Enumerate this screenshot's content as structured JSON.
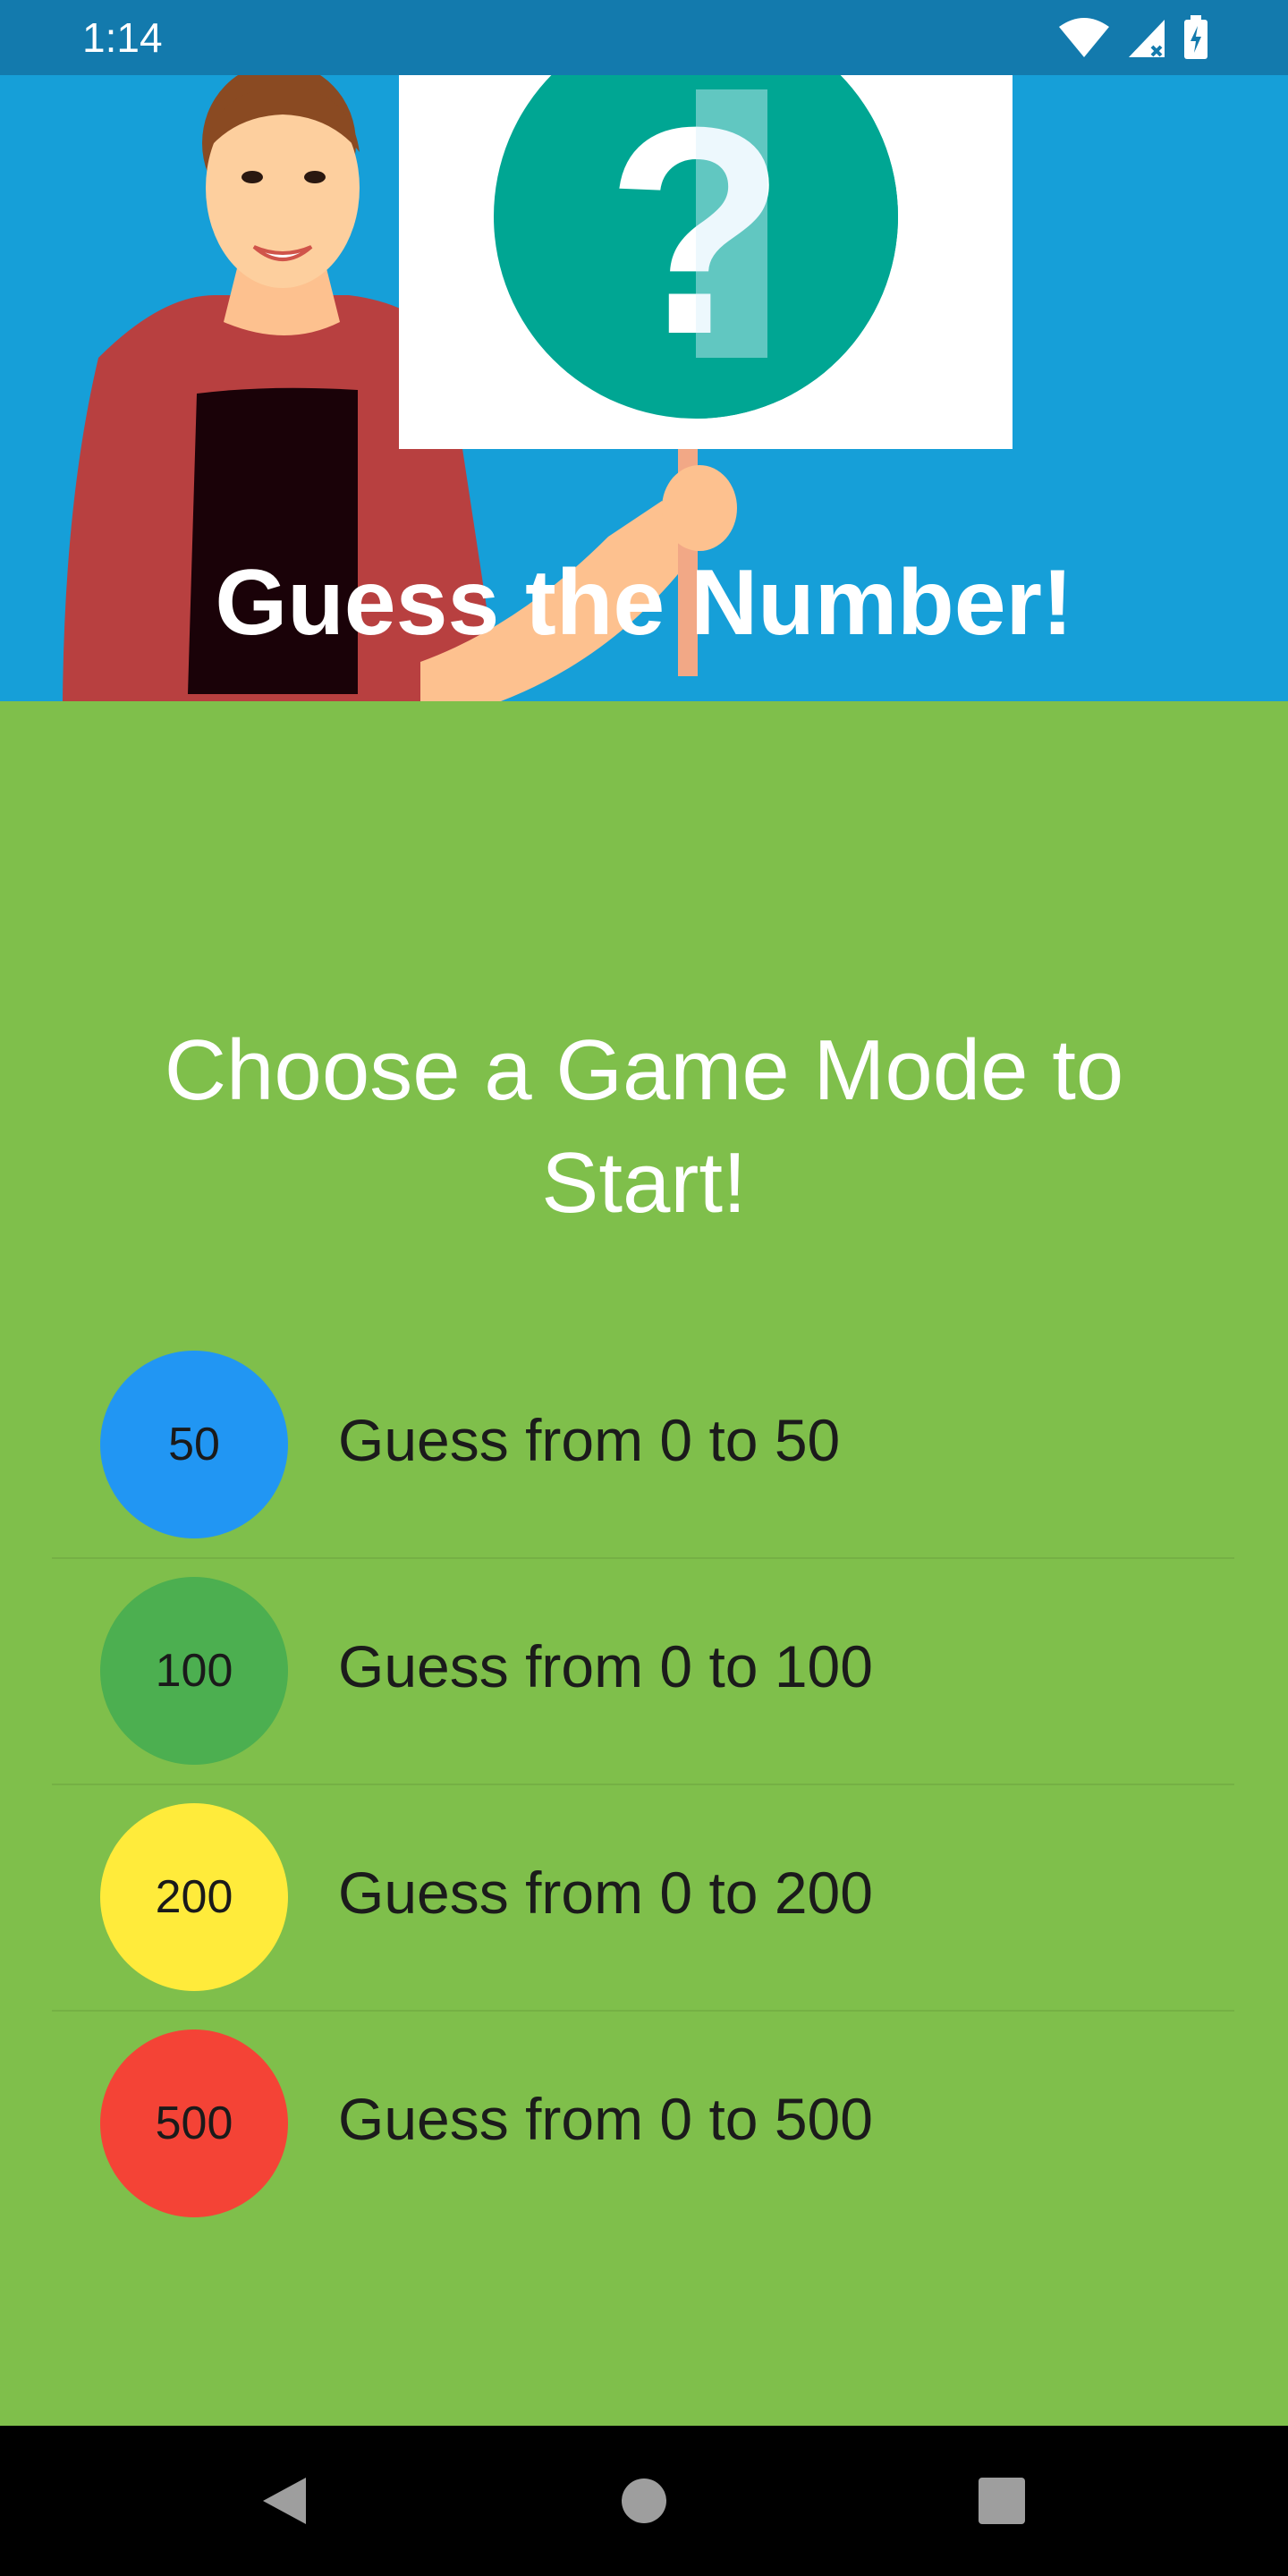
{
  "status_bar": {
    "time": "1:14",
    "icons": [
      "wifi-icon",
      "signal-icon",
      "battery-charging-icon"
    ]
  },
  "header": {
    "title": "Guess the Number!",
    "sign_glyph": "?"
  },
  "main": {
    "prompt": "Choose a Game Mode to Start!",
    "modes": [
      {
        "badge": "50",
        "label": "Guess from 0 to 50",
        "color": "#2196f3"
      },
      {
        "badge": "100",
        "label": "Guess from 0 to 100",
        "color": "#4caf50"
      },
      {
        "badge": "200",
        "label": "Guess from 0 to 200",
        "color": "#ffeb3b"
      },
      {
        "badge": "500",
        "label": "Guess from 0 to 500",
        "color": "#f44336"
      }
    ]
  },
  "colors": {
    "status_bar": "#137aad",
    "header_bg": "#169fd8",
    "main_bg": "#7fbf4b",
    "sign_circle": "#00a693"
  },
  "nav_bar": {
    "buttons": [
      "back-icon",
      "home-icon",
      "recents-icon"
    ]
  }
}
